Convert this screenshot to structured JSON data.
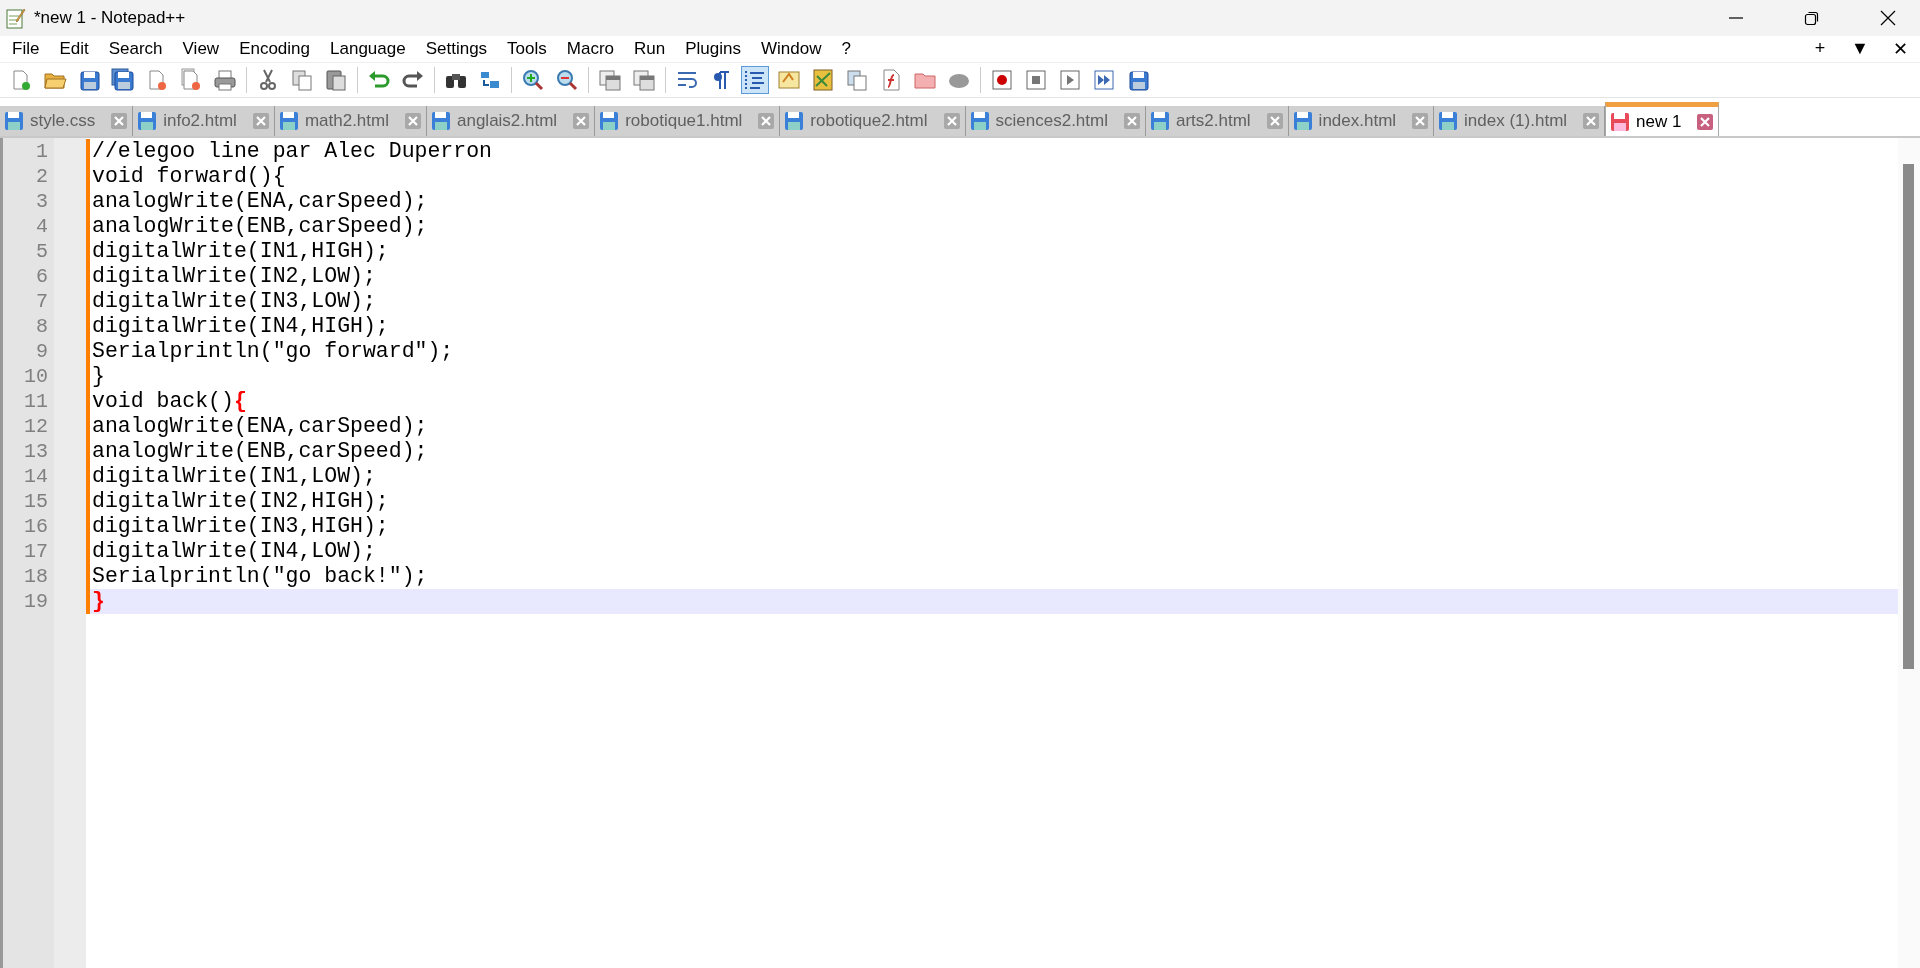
{
  "window": {
    "title": "*new 1 - Notepad++"
  },
  "menu": [
    "File",
    "Edit",
    "Search",
    "View",
    "Encoding",
    "Language",
    "Settings",
    "Tools",
    "Macro",
    "Run",
    "Plugins",
    "Window",
    "?"
  ],
  "menu_controls": [
    "+",
    "▼",
    "✕"
  ],
  "toolbar": [
    {
      "kind": "new",
      "pressed": false
    },
    {
      "kind": "open",
      "pressed": false
    },
    {
      "kind": "save",
      "pressed": false
    },
    {
      "kind": "save-all",
      "pressed": false
    },
    {
      "kind": "close",
      "pressed": false
    },
    {
      "kind": "close-all",
      "pressed": false
    },
    {
      "kind": "print",
      "pressed": false
    },
    {
      "kind": "separator"
    },
    {
      "kind": "cut",
      "pressed": false
    },
    {
      "kind": "copy",
      "pressed": false
    },
    {
      "kind": "paste",
      "pressed": false
    },
    {
      "kind": "separator"
    },
    {
      "kind": "undo",
      "pressed": false
    },
    {
      "kind": "redo",
      "pressed": false
    },
    {
      "kind": "separator"
    },
    {
      "kind": "find",
      "pressed": false
    },
    {
      "kind": "replace",
      "pressed": false
    },
    {
      "kind": "separator"
    },
    {
      "kind": "zoom-in",
      "pressed": false
    },
    {
      "kind": "zoom-out",
      "pressed": false
    },
    {
      "kind": "separator"
    },
    {
      "kind": "sync-v",
      "pressed": false
    },
    {
      "kind": "sync-h",
      "pressed": false
    },
    {
      "kind": "separator"
    },
    {
      "kind": "wrap",
      "pressed": false
    },
    {
      "kind": "pilcrow",
      "pressed": false
    },
    {
      "kind": "indent-guide",
      "pressed": true
    },
    {
      "kind": "udl",
      "pressed": false
    },
    {
      "kind": "doc-map",
      "pressed": false
    },
    {
      "kind": "doc-list",
      "pressed": false
    },
    {
      "kind": "function-list",
      "pressed": false
    },
    {
      "kind": "folder",
      "pressed": false
    },
    {
      "kind": "monitor",
      "pressed": false
    },
    {
      "kind": "separator"
    },
    {
      "kind": "record",
      "pressed": false
    },
    {
      "kind": "stop",
      "pressed": false
    },
    {
      "kind": "play",
      "pressed": false
    },
    {
      "kind": "play-multi",
      "pressed": false
    },
    {
      "kind": "save-macro",
      "pressed": false
    }
  ],
  "tabs": [
    {
      "label": "style.css",
      "selected": false,
      "modified": false
    },
    {
      "label": "info2.html",
      "selected": false,
      "modified": false
    },
    {
      "label": "math2.html",
      "selected": false,
      "modified": false
    },
    {
      "label": "anglais2.html",
      "selected": false,
      "modified": false
    },
    {
      "label": "robotique1.html",
      "selected": false,
      "modified": false
    },
    {
      "label": "robotique2.html",
      "selected": false,
      "modified": false
    },
    {
      "label": "sciences2.html",
      "selected": false,
      "modified": false
    },
    {
      "label": "arts2.html",
      "selected": false,
      "modified": false
    },
    {
      "label": "index.html",
      "selected": false,
      "modified": false
    },
    {
      "label": "index (1).html",
      "selected": false,
      "modified": false
    },
    {
      "label": "new 1",
      "selected": true,
      "modified": true
    }
  ],
  "editor": {
    "lines": [
      {
        "number": "1",
        "text": "//elegoo line par Alec Duperron",
        "current": false,
        "brace_match": false
      },
      {
        "number": "2",
        "text": "void forward(){",
        "current": false,
        "brace_match": false
      },
      {
        "number": "3",
        "text": "analogWrite(ENA,carSpeed);",
        "current": false,
        "brace_match": false
      },
      {
        "number": "4",
        "text": "analogWrite(ENB,carSpeed);",
        "current": false,
        "brace_match": false
      },
      {
        "number": "5",
        "text": "digitalWrite(IN1,HIGH);",
        "current": false,
        "brace_match": false
      },
      {
        "number": "6",
        "text": "digitalWrite(IN2,LOW);",
        "current": false,
        "brace_match": false
      },
      {
        "number": "7",
        "text": "digitalWrite(IN3,LOW);",
        "current": false,
        "brace_match": false
      },
      {
        "number": "8",
        "text": "digitalWrite(IN4,HIGH);",
        "current": false,
        "brace_match": false
      },
      {
        "number": "9",
        "text": "Serialprintln(\"go forward\");",
        "current": false,
        "brace_match": false
      },
      {
        "number": "10",
        "text": "}",
        "current": false,
        "brace_match": false
      },
      {
        "number": "11",
        "text": "void back(){",
        "current": false,
        "brace_match": true
      },
      {
        "number": "12",
        "text": "analogWrite(ENA,carSpeed);",
        "current": false,
        "brace_match": false
      },
      {
        "number": "13",
        "text": "analogWrite(ENB,carSpeed);",
        "current": false,
        "brace_match": false
      },
      {
        "number": "14",
        "text": "digitalWrite(IN1,LOW);",
        "current": false,
        "brace_match": false
      },
      {
        "number": "15",
        "text": "digitalWrite(IN2,HIGH);",
        "current": false,
        "brace_match": false
      },
      {
        "number": "16",
        "text": "digitalWrite(IN3,HIGH);",
        "current": false,
        "brace_match": false
      },
      {
        "number": "17",
        "text": "digitalWrite(IN4,LOW);",
        "current": false,
        "brace_match": false
      },
      {
        "number": "18",
        "text": "Serialprintln(\"go back!\");",
        "current": false,
        "brace_match": false
      },
      {
        "number": "19",
        "text": "}",
        "current": true,
        "brace_match": true
      }
    ]
  }
}
